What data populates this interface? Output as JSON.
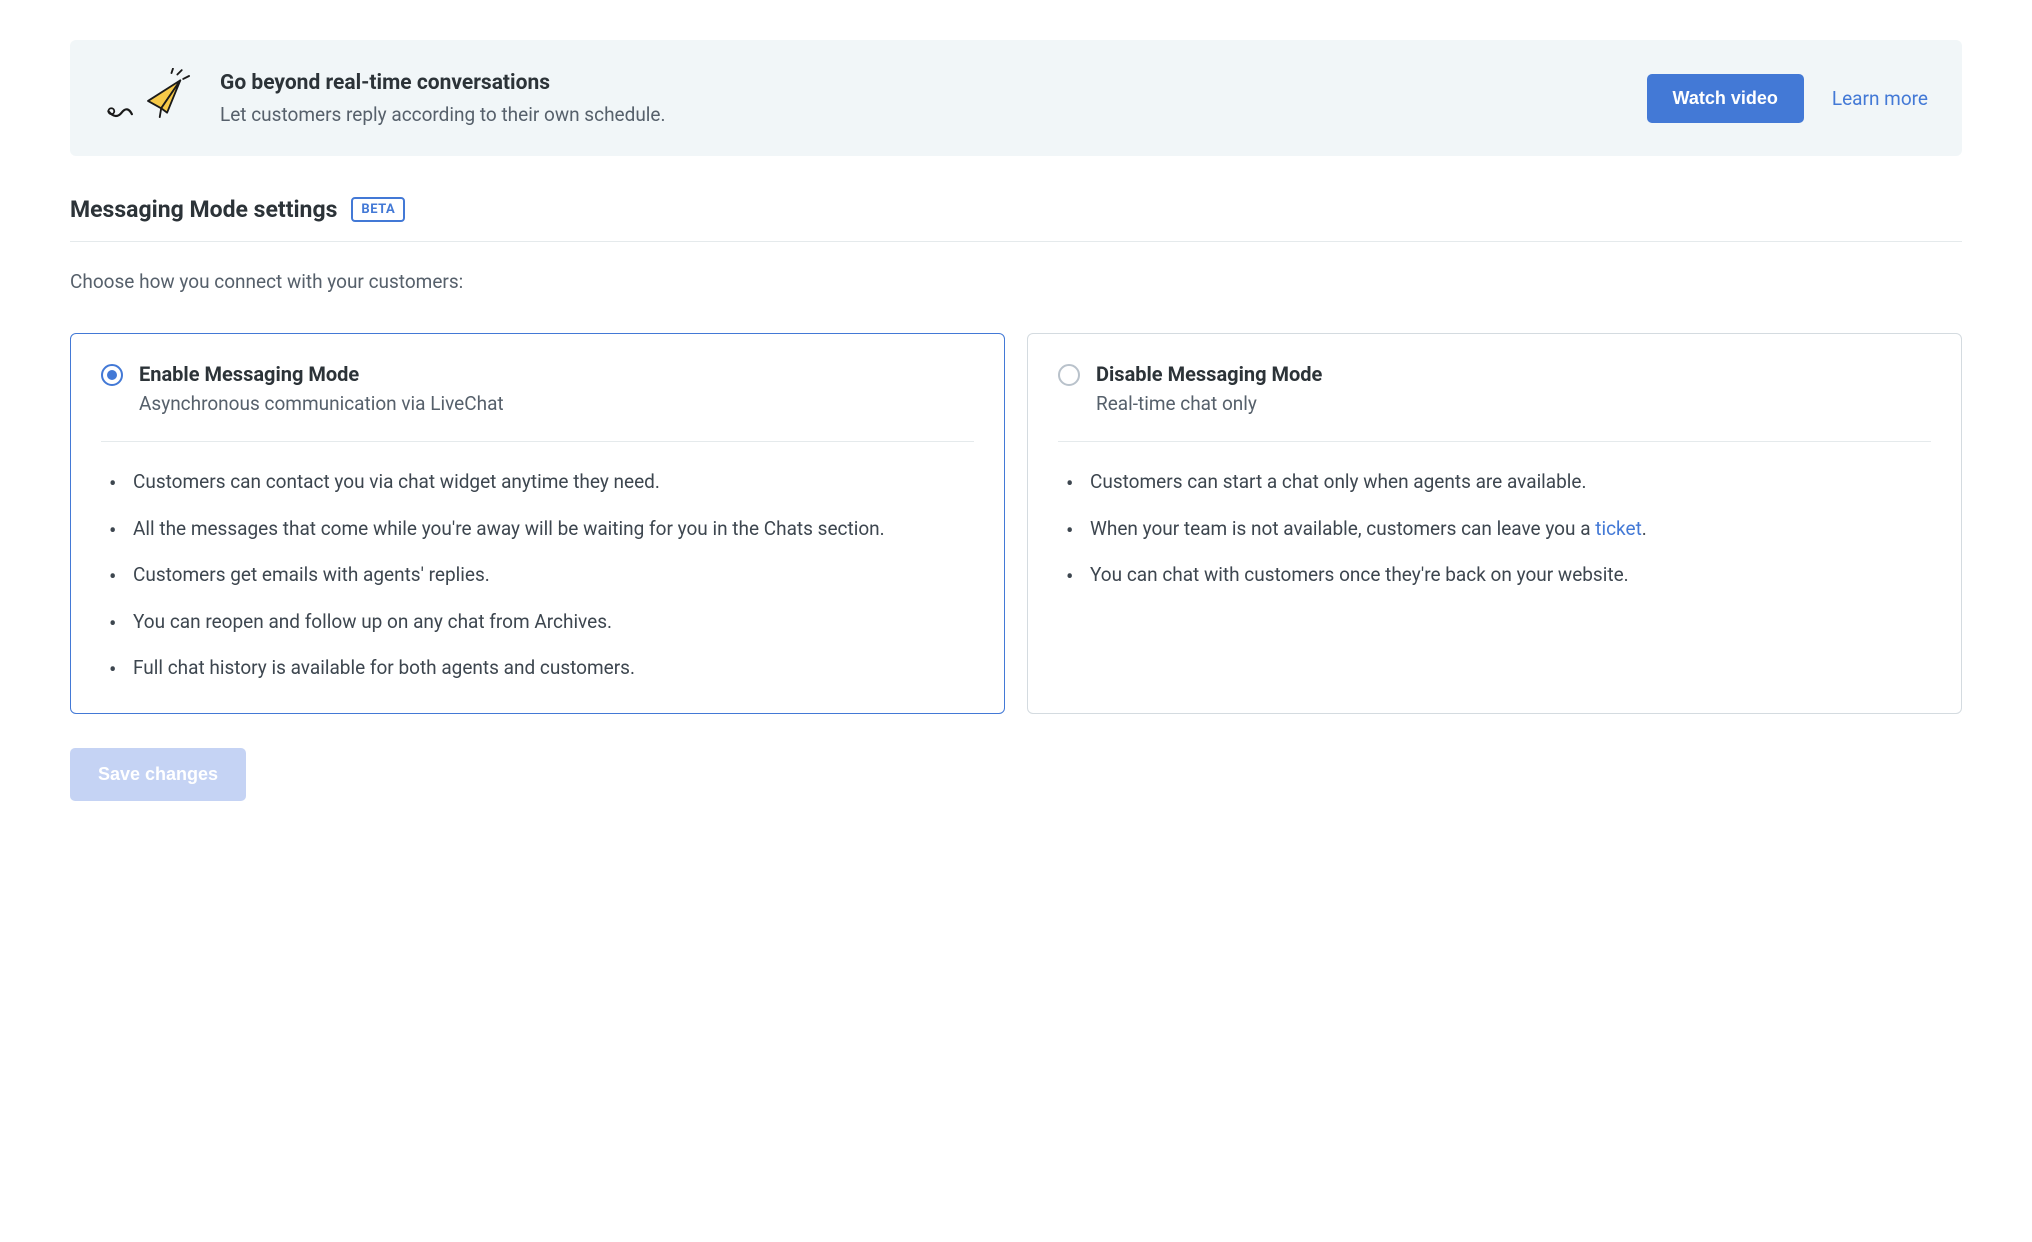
{
  "promo": {
    "title": "Go beyond real-time conversations",
    "subtitle": "Let customers reply according to their own schedule.",
    "watch_label": "Watch video",
    "learn_label": "Learn more"
  },
  "section": {
    "title": "Messaging Mode settings",
    "badge": "BETA"
  },
  "instruction": "Choose how you connect with your customers:",
  "options": {
    "enable": {
      "title": "Enable Messaging Mode",
      "subtitle": "Asynchronous communication via LiveChat",
      "bullets": [
        "Customers can contact you via chat widget anytime they need.",
        "All the messages that come while you're away will be waiting for you in the Chats section.",
        "Customers get emails with agents' replies.",
        "You can reopen and follow up on any chat from Archives.",
        "Full chat history is available for both agents and customers."
      ],
      "selected": true
    },
    "disable": {
      "title": "Disable Messaging Mode",
      "subtitle": "Real-time chat only",
      "bullets_pre": [
        "Customers can start a chat only when agents are available."
      ],
      "bullet_link_pre": "When your team is not available, customers can leave you a ",
      "bullet_link_text": "ticket",
      "bullet_link_post": ".",
      "bullets_post": [
        "You can chat with customers once they're back on your website."
      ],
      "selected": false
    }
  },
  "save_label": "Save changes"
}
